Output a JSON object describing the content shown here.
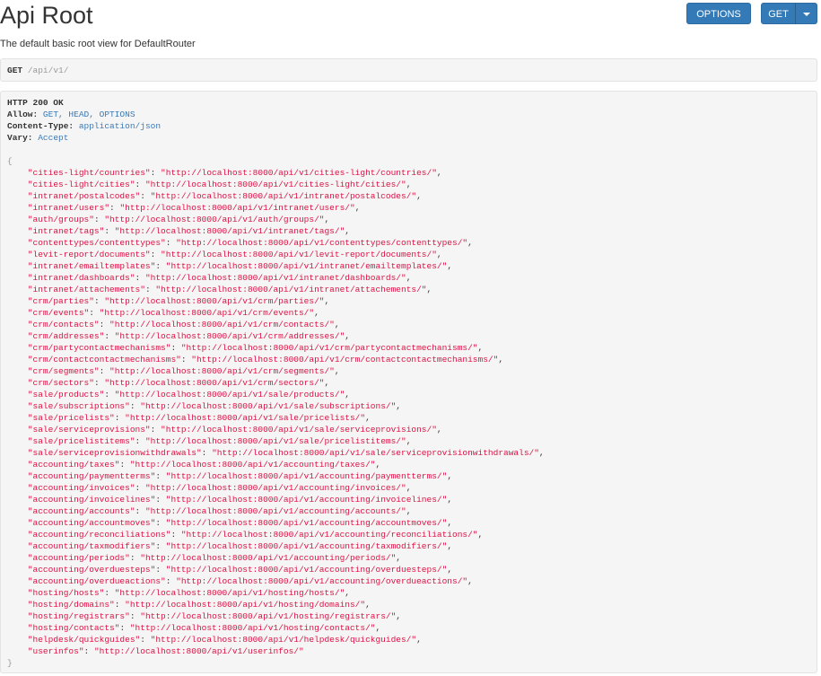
{
  "header": {
    "title": "Api Root",
    "description": "The default basic root view for DefaultRouter"
  },
  "toolbar": {
    "options_label": "OPTIONS",
    "get_label": "GET"
  },
  "request": {
    "method": "GET",
    "path": "/api/v1/"
  },
  "response": {
    "status": "HTTP 200 OK",
    "headers": [
      {
        "key": "Allow:",
        "value": "GET, HEAD, OPTIONS"
      },
      {
        "key": "Content-Type:",
        "value": "application/json"
      },
      {
        "key": "Vary:",
        "value": "Accept"
      }
    ],
    "open_brace": "{",
    "close_brace": "}",
    "entries": [
      {
        "key": "\"cities-light/countries\"",
        "value": "\"http://localhost:8000/api/v1/cities-light/countries/\""
      },
      {
        "key": "\"cities-light/cities\"",
        "value": "\"http://localhost:8000/api/v1/cities-light/cities/\""
      },
      {
        "key": "\"intranet/postalcodes\"",
        "value": "\"http://localhost:8000/api/v1/intranet/postalcodes/\""
      },
      {
        "key": "\"intranet/users\"",
        "value": "\"http://localhost:8000/api/v1/intranet/users/\""
      },
      {
        "key": "\"auth/groups\"",
        "value": "\"http://localhost:8000/api/v1/auth/groups/\""
      },
      {
        "key": "\"intranet/tags\"",
        "value": "\"http://localhost:8000/api/v1/intranet/tags/\""
      },
      {
        "key": "\"contenttypes/contenttypes\"",
        "value": "\"http://localhost:8000/api/v1/contenttypes/contenttypes/\""
      },
      {
        "key": "\"levit-report/documents\"",
        "value": "\"http://localhost:8000/api/v1/levit-report/documents/\""
      },
      {
        "key": "\"intranet/emailtemplates\"",
        "value": "\"http://localhost:8000/api/v1/intranet/emailtemplates/\""
      },
      {
        "key": "\"intranet/dashboards\"",
        "value": "\"http://localhost:8000/api/v1/intranet/dashboards/\""
      },
      {
        "key": "\"intranet/attachements\"",
        "value": "\"http://localhost:8000/api/v1/intranet/attachements/\""
      },
      {
        "key": "\"crm/parties\"",
        "value": "\"http://localhost:8000/api/v1/crm/parties/\""
      },
      {
        "key": "\"crm/events\"",
        "value": "\"http://localhost:8000/api/v1/crm/events/\""
      },
      {
        "key": "\"crm/contacts\"",
        "value": "\"http://localhost:8000/api/v1/crm/contacts/\""
      },
      {
        "key": "\"crm/addresses\"",
        "value": "\"http://localhost:8000/api/v1/crm/addresses/\""
      },
      {
        "key": "\"crm/partycontactmechanisms\"",
        "value": "\"http://localhost:8000/api/v1/crm/partycontactmechanisms/\""
      },
      {
        "key": "\"crm/contactcontactmechanisms\"",
        "value": "\"http://localhost:8000/api/v1/crm/contactcontactmechanisms/\""
      },
      {
        "key": "\"crm/segments\"",
        "value": "\"http://localhost:8000/api/v1/crm/segments/\""
      },
      {
        "key": "\"crm/sectors\"",
        "value": "\"http://localhost:8000/api/v1/crm/sectors/\""
      },
      {
        "key": "\"sale/products\"",
        "value": "\"http://localhost:8000/api/v1/sale/products/\""
      },
      {
        "key": "\"sale/subscriptions\"",
        "value": "\"http://localhost:8000/api/v1/sale/subscriptions/\""
      },
      {
        "key": "\"sale/pricelists\"",
        "value": "\"http://localhost:8000/api/v1/sale/pricelists/\""
      },
      {
        "key": "\"sale/serviceprovisions\"",
        "value": "\"http://localhost:8000/api/v1/sale/serviceprovisions/\""
      },
      {
        "key": "\"sale/pricelistitems\"",
        "value": "\"http://localhost:8000/api/v1/sale/pricelistitems/\""
      },
      {
        "key": "\"sale/serviceprovisionwithdrawals\"",
        "value": "\"http://localhost:8000/api/v1/sale/serviceprovisionwithdrawals/\""
      },
      {
        "key": "\"accounting/taxes\"",
        "value": "\"http://localhost:8000/api/v1/accounting/taxes/\""
      },
      {
        "key": "\"accounting/paymentterms\"",
        "value": "\"http://localhost:8000/api/v1/accounting/paymentterms/\""
      },
      {
        "key": "\"accounting/invoices\"",
        "value": "\"http://localhost:8000/api/v1/accounting/invoices/\""
      },
      {
        "key": "\"accounting/invoicelines\"",
        "value": "\"http://localhost:8000/api/v1/accounting/invoicelines/\""
      },
      {
        "key": "\"accounting/accounts\"",
        "value": "\"http://localhost:8000/api/v1/accounting/accounts/\""
      },
      {
        "key": "\"accounting/accountmoves\"",
        "value": "\"http://localhost:8000/api/v1/accounting/accountmoves/\""
      },
      {
        "key": "\"accounting/reconciliations\"",
        "value": "\"http://localhost:8000/api/v1/accounting/reconciliations/\""
      },
      {
        "key": "\"accounting/taxmodifiers\"",
        "value": "\"http://localhost:8000/api/v1/accounting/taxmodifiers/\""
      },
      {
        "key": "\"accounting/periods\"",
        "value": "\"http://localhost:8000/api/v1/accounting/periods/\""
      },
      {
        "key": "\"accounting/overduesteps\"",
        "value": "\"http://localhost:8000/api/v1/accounting/overduesteps/\""
      },
      {
        "key": "\"accounting/overdueactions\"",
        "value": "\"http://localhost:8000/api/v1/accounting/overdueactions/\""
      },
      {
        "key": "\"hosting/hosts\"",
        "value": "\"http://localhost:8000/api/v1/hosting/hosts/\""
      },
      {
        "key": "\"hosting/domains\"",
        "value": "\"http://localhost:8000/api/v1/hosting/domains/\""
      },
      {
        "key": "\"hosting/registrars\"",
        "value": "\"http://localhost:8000/api/v1/hosting/registrars/\""
      },
      {
        "key": "\"hosting/contacts\"",
        "value": "\"http://localhost:8000/api/v1/hosting/contacts/\""
      },
      {
        "key": "\"helpdesk/quickguides\"",
        "value": "\"http://localhost:8000/api/v1/helpdesk/quickguides/\""
      },
      {
        "key": "\"userinfos\"",
        "value": "\"http://localhost:8000/api/v1/userinfos/\""
      }
    ]
  }
}
